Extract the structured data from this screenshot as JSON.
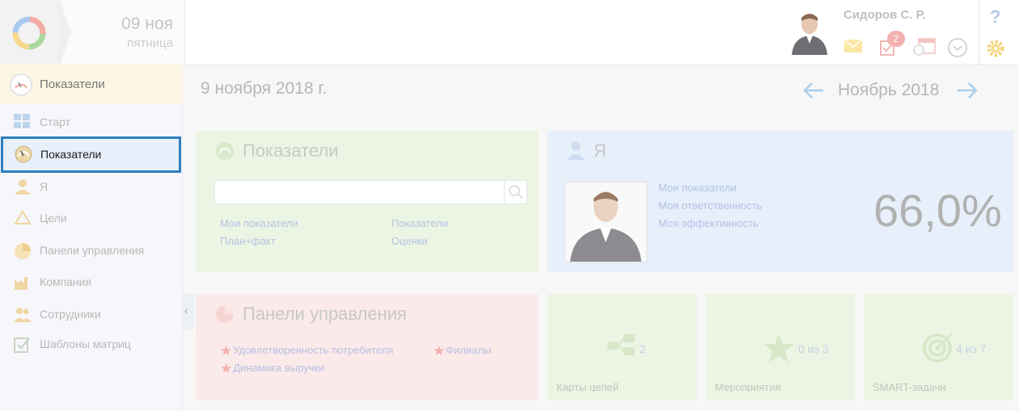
{
  "header": {
    "date_day": "09 ноя",
    "date_weekday": "пятница",
    "user_name": "Сидоров С. Р.",
    "tasks_badge": "2",
    "help": "?"
  },
  "sidebar": {
    "section_title": "Показатели",
    "items": [
      {
        "label": "Старт",
        "icon": "grid-icon"
      },
      {
        "label": "Показатели",
        "icon": "gauge-icon",
        "active": true
      },
      {
        "label": "Я",
        "icon": "person-icon"
      },
      {
        "label": "Цели",
        "icon": "target-hanger-icon"
      },
      {
        "label": "Панели управления",
        "icon": "pie-icon"
      },
      {
        "label": "Компания",
        "icon": "factory-icon"
      },
      {
        "label": "Сотрудники",
        "icon": "people-icon"
      },
      {
        "label": "Шаблоны матриц",
        "icon": "template-check-icon"
      }
    ]
  },
  "main": {
    "date_title": "9 ноября 2018 г.",
    "month_label": "Ноябрь 2018",
    "indicators": {
      "title": "Показатели",
      "search_value": "",
      "links": [
        "Мои показатели",
        "План+факт",
        "Показатели",
        "Оценки"
      ]
    },
    "me": {
      "title": "Я",
      "links": [
        "Мои показатели",
        "Моя ответственность",
        "Моя эффективность"
      ],
      "efficiency": "66,0%"
    },
    "dashboards": {
      "title": "Панели управления",
      "favorites": [
        "Удовлетворенность потребителя",
        "Динамика выручки",
        "Филиалы"
      ]
    },
    "tiles": [
      {
        "label": "Карты целей",
        "count": "2"
      },
      {
        "label": "Мероприятия",
        "count": "0 из 3"
      },
      {
        "label": "SMART-задачи",
        "count": "4 из 7"
      }
    ]
  },
  "colors": {
    "accent": "#2f7fbf",
    "green_card": "#ecf5e3",
    "blue_card": "#e6effa",
    "pink_card": "#fbeaea",
    "nav_arrow": "#a9cdec",
    "star": "#f2b1ad"
  }
}
